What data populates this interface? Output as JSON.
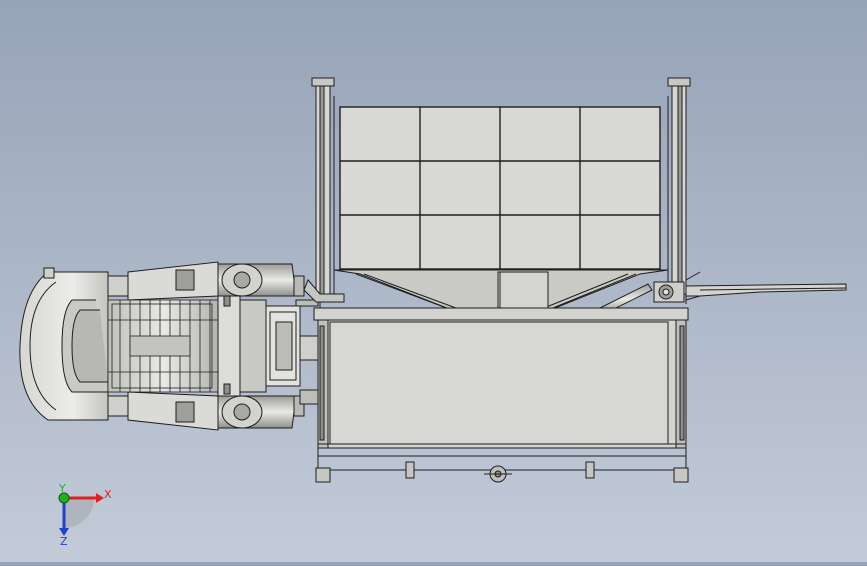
{
  "viewport": {
    "background_top": "#97a3b7",
    "background_bottom": "#c3cbd8",
    "line_color": "#1e1e1e",
    "part_fill": "#d8d9d4",
    "panel_fill": "#cfd0cb",
    "shade_fill": "#a9aaa6"
  },
  "triad": {
    "x_label": "X",
    "y_label": "Y",
    "z_label": "Z",
    "x_color": "#e02020",
    "y_color": "#20b020",
    "z_color": "#2040d0"
  },
  "panels": {
    "rows": 3,
    "cols": 4
  },
  "icons": [
    "coordinate-triad-icon"
  ]
}
